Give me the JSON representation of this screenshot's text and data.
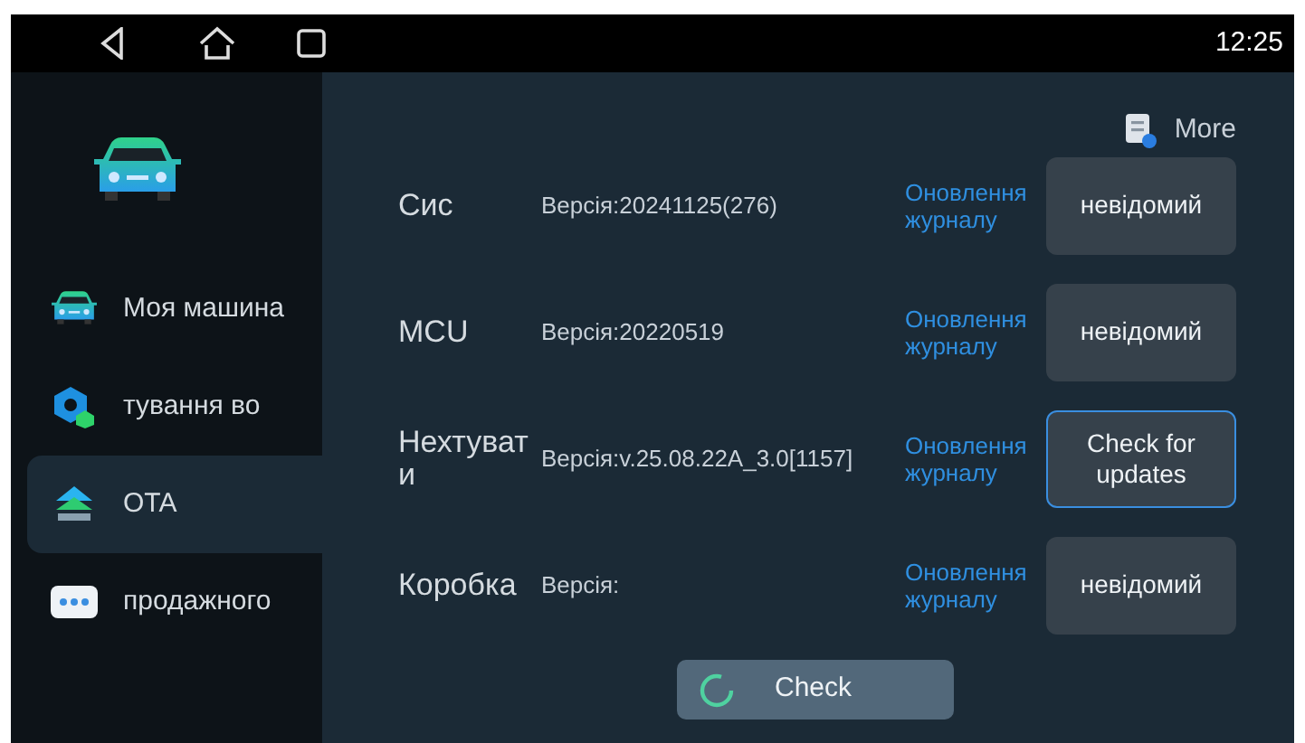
{
  "status_bar": {
    "time": "12:25"
  },
  "sidebar": {
    "items": [
      {
        "kind": "car",
        "label": "Моя машина",
        "selected": false
      },
      {
        "kind": "hex",
        "label": "тування во",
        "selected": false
      },
      {
        "kind": "ota",
        "label": "OTA",
        "selected": true
      },
      {
        "kind": "dots",
        "label": "продажного",
        "selected": false
      }
    ]
  },
  "more": {
    "label": "More"
  },
  "modules": [
    {
      "name": "Сис",
      "version": "Версія:20241125(276)",
      "log_link": "Оновлення журналу",
      "button": "невідомий",
      "highlighted": false
    },
    {
      "name": "MCU",
      "version": "Версія:20220519",
      "log_link": "Оновлення журналу",
      "button": "невідомий",
      "highlighted": false
    },
    {
      "name": "Нехтувати",
      "version": "Версія:v.25.08.22A_3.0[1157]",
      "log_link": "Оновлення журналу",
      "button": "Check for updates",
      "highlighted": true
    },
    {
      "name": "Коробка",
      "version": "Версія:",
      "log_link": "Оновлення журналу",
      "button": "невідомий",
      "highlighted": false
    }
  ],
  "check_button": {
    "label": "Check"
  }
}
